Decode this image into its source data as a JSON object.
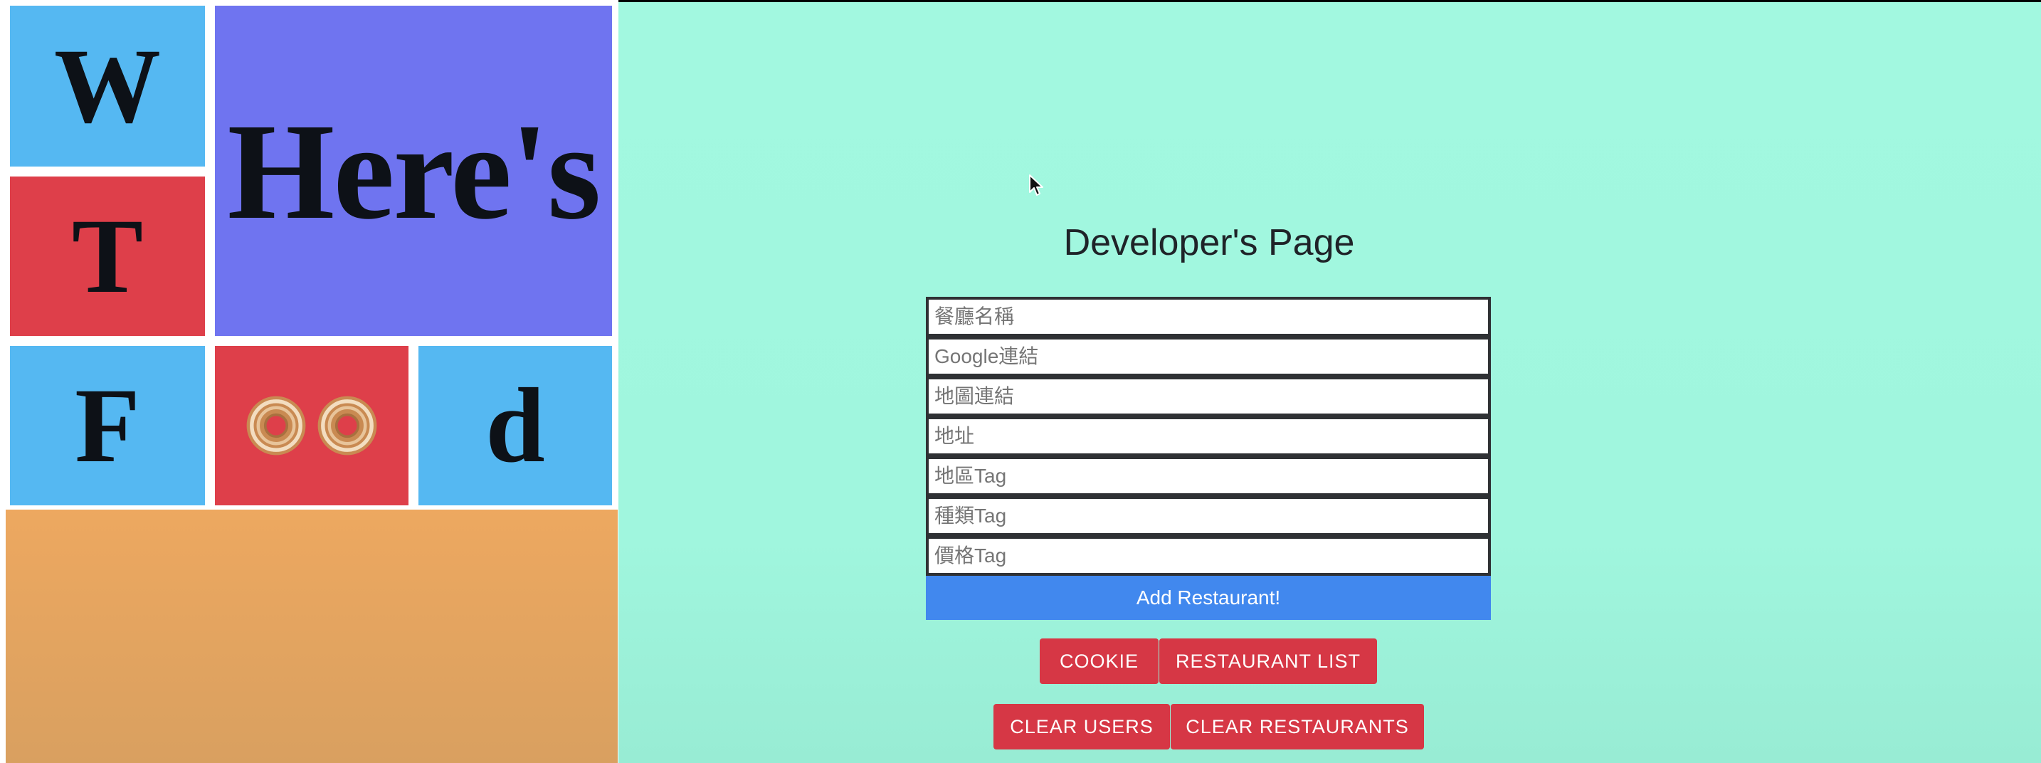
{
  "logo": {
    "letters": [
      "W",
      "T",
      "F",
      "d"
    ],
    "big_word": "Here's"
  },
  "page": {
    "title": "Developer's Page"
  },
  "form": {
    "fields": [
      {
        "placeholder": "餐廳名稱"
      },
      {
        "placeholder": "Google連結"
      },
      {
        "placeholder": "地圖連結"
      },
      {
        "placeholder": "地址"
      },
      {
        "placeholder": "地區Tag"
      },
      {
        "placeholder": "種類Tag"
      },
      {
        "placeholder": "價格Tag"
      }
    ],
    "submit_label": "Add Restaurant!"
  },
  "actions": {
    "cookie": "COOKIE",
    "restaurant_list": "RESTAURANT LIST",
    "clear_users": "CLEAR USERS",
    "clear_restaurants": "CLEAR RESTAURANTS"
  },
  "colors": {
    "background": "#a2f8e0",
    "accent_blue": "#4188ee",
    "danger_red": "#d63745",
    "tile_blue": "#55b8f2",
    "tile_red": "#de3f4a",
    "tile_purple": "#6f74f0",
    "tile_orange": "#eda860"
  },
  "icons": [
    "donut-icon",
    "cursor-icon"
  ]
}
